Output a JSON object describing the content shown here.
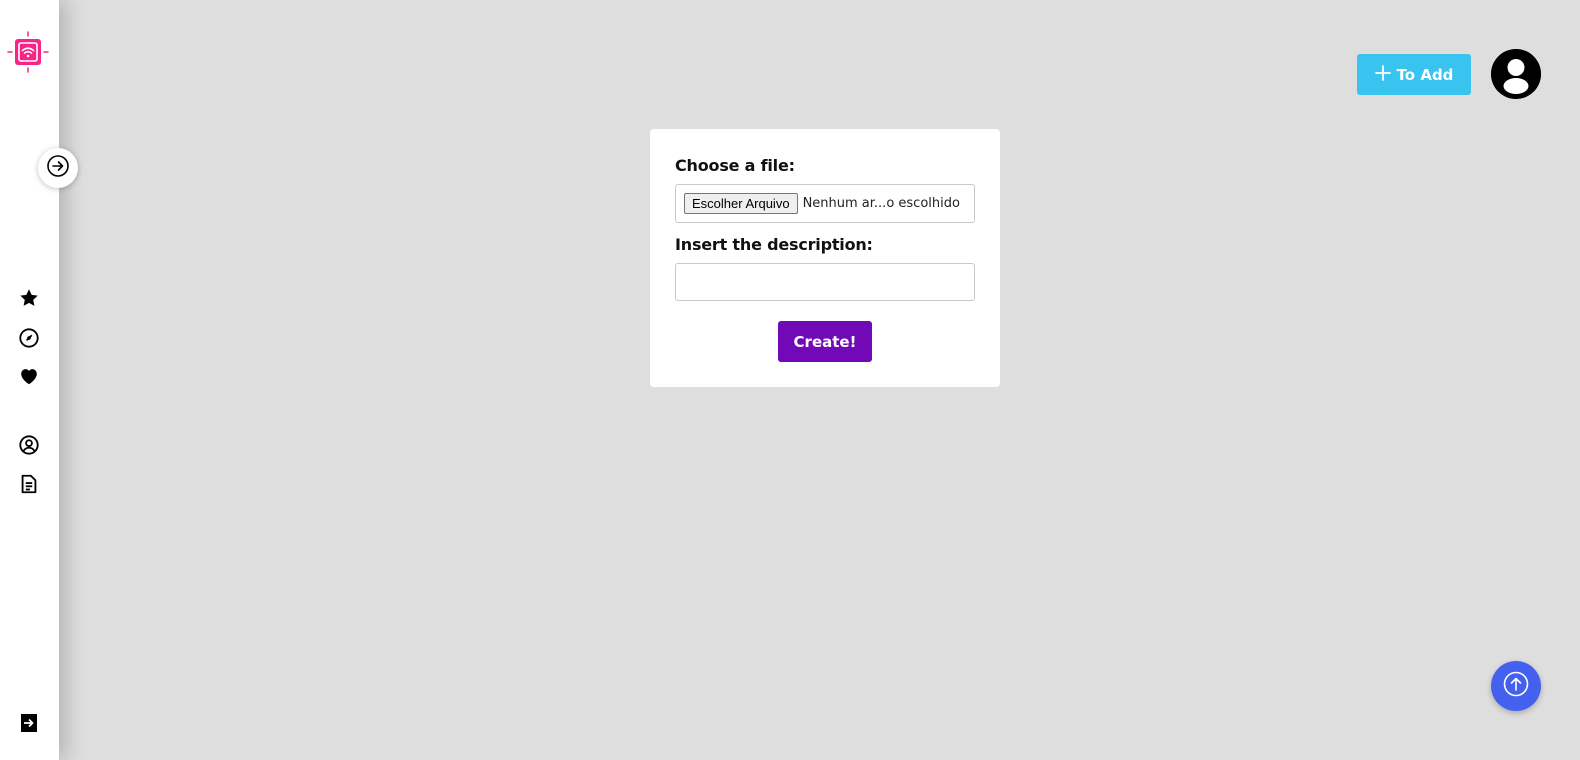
{
  "sidebar": {
    "logo_icon": "wifi-chip-icon",
    "expand_icon": "arrow-right-circle-icon",
    "nav_icons": [
      "star-icon",
      "compass-icon",
      "heart-icon",
      "user-circle-icon",
      "document-icon"
    ],
    "logout_icon": "logout-icon"
  },
  "header": {
    "add_button_label": "To Add",
    "add_icon": "plus-icon",
    "avatar_icon": "user-avatar-icon"
  },
  "form": {
    "file_label": "Choose a file:",
    "file_button_label": "Escolher Arquivo",
    "file_status": "Nenhum ar...o escolhido",
    "description_label": "Insert the description:",
    "description_value": "",
    "submit_label": "Create!"
  },
  "scroll_top_icon": "arrow-up-circle-icon",
  "colors": {
    "background": "#dedede",
    "add_button": "#38c4ee",
    "create_button": "#7209b7",
    "scroll_top": "#4361ee",
    "logo": "#f72585"
  }
}
